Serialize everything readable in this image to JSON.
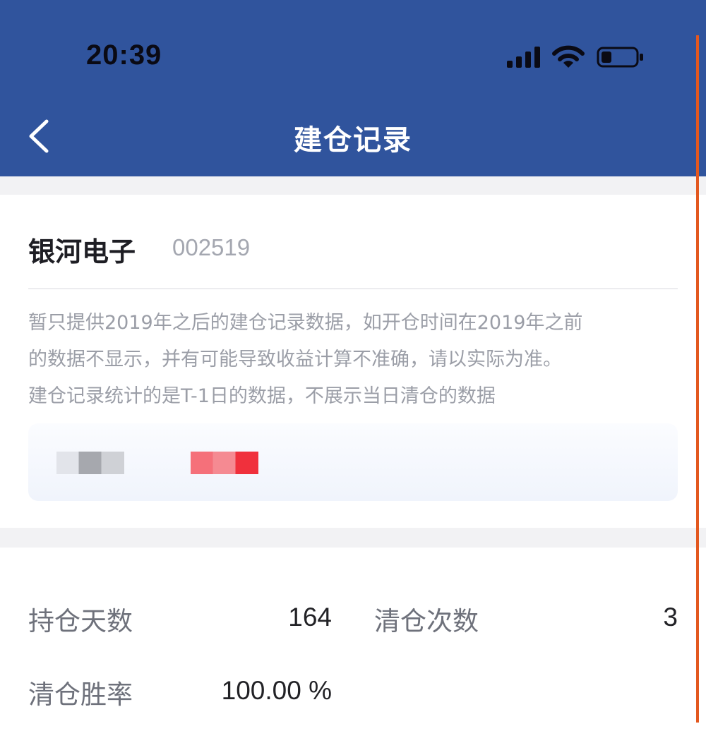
{
  "status_bar": {
    "time": "20:39",
    "icons": [
      "signal-icon",
      "wifi-icon",
      "battery-icon"
    ]
  },
  "nav": {
    "back_icon": "chevron-left-icon",
    "title": "建仓记录"
  },
  "stock": {
    "name": "银河电子",
    "code": "002519",
    "notice": "暂只提供2019年之后的建仓记录数据，如开仓时间在2019年之前\n的数据不显示，并有可能导致收益计算不准确，请以实际为准。\n建仓记录统计的是T-1日的数据，不展示当日清仓的数据"
  },
  "stats": {
    "holding_days_label": "持仓天数",
    "holding_days_value": "164",
    "clear_count_label": "清仓次数",
    "clear_count_value": "3",
    "win_rate_label": "清仓胜率",
    "win_rate_value": "100.00 %"
  },
  "colors": {
    "header_bg": "#30549d",
    "accent_red": "#f0303c",
    "scroll_line": "#e3581f"
  }
}
